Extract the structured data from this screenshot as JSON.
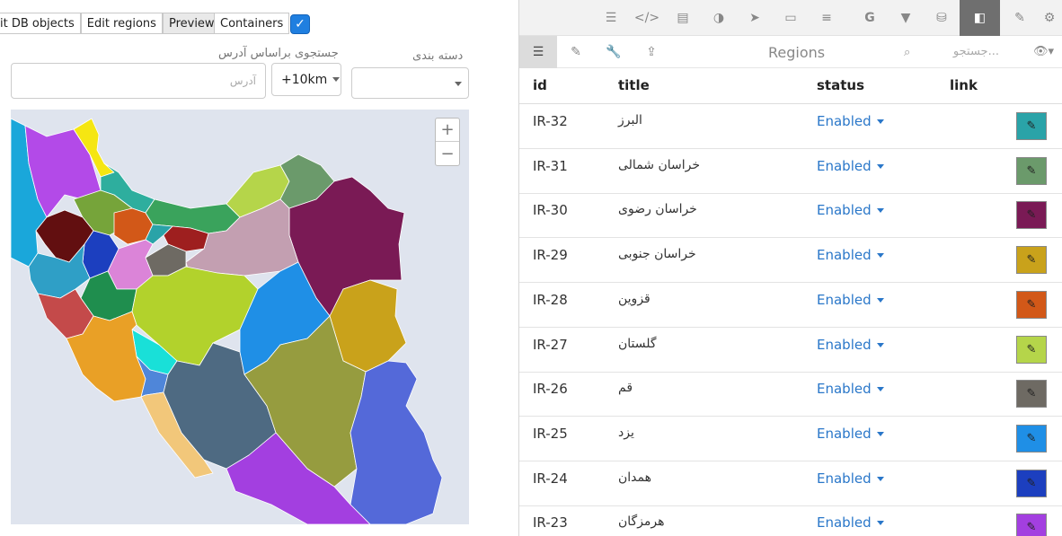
{
  "left": {
    "tabs": [
      {
        "label": "it DB objects",
        "active": false
      },
      {
        "label": "Edit regions",
        "active": false
      },
      {
        "label": "Preview",
        "active": true
      }
    ],
    "containers_label": "Containers",
    "containers_checked": true,
    "address_label": "جستجوی براساس آدرس",
    "address_placeholder": "آدرس",
    "radius_value": "+10km",
    "category_label": "دسته بندی",
    "category_value": "",
    "zoom_in": "+",
    "zoom_out": "−"
  },
  "right": {
    "toolbar_icons": [
      "code-block-icon",
      "code-icon",
      "file-icon",
      "toggle-icon",
      "pointer-icon",
      "card-icon",
      "list-icon",
      "google-icon",
      "filter-icon",
      "database-icon",
      "map-frame-icon",
      "brush-icon",
      "gear-icon"
    ],
    "active_toolbar_icon": "map-frame-icon",
    "subtools": [
      "list-icon",
      "edit-icon",
      "wrench-icon",
      "upload-icon"
    ],
    "title": "Regions",
    "search_placeholder": "جستجو...",
    "columns": [
      "id",
      "title",
      "status",
      "link"
    ],
    "rows": [
      {
        "id": "IR-32",
        "title": "البرز",
        "status": "Enabled",
        "color": "#2aa3a8"
      },
      {
        "id": "IR-31",
        "title": "خراسان شمالی",
        "status": "Enabled",
        "color": "#6b9a6b"
      },
      {
        "id": "IR-30",
        "title": "خراسان رضوی",
        "status": "Enabled",
        "color": "#7a1a55"
      },
      {
        "id": "IR-29",
        "title": "خراسان جنوبی",
        "status": "Enabled",
        "color": "#c9a21b"
      },
      {
        "id": "IR-28",
        "title": "قزوین",
        "status": "Enabled",
        "color": "#d25818"
      },
      {
        "id": "IR-27",
        "title": "گلستان",
        "status": "Enabled",
        "color": "#b5d54a"
      },
      {
        "id": "IR-26",
        "title": "قم",
        "status": "Enabled",
        "color": "#6e6a63"
      },
      {
        "id": "IR-25",
        "title": "یزد",
        "status": "Enabled",
        "color": "#1f8fe6"
      },
      {
        "id": "IR-24",
        "title": "همدان",
        "status": "Enabled",
        "color": "#1c3fbf"
      },
      {
        "id": "IR-23",
        "title": "هرمزگان",
        "status": "Enabled",
        "color": "#a33fe0"
      }
    ]
  }
}
